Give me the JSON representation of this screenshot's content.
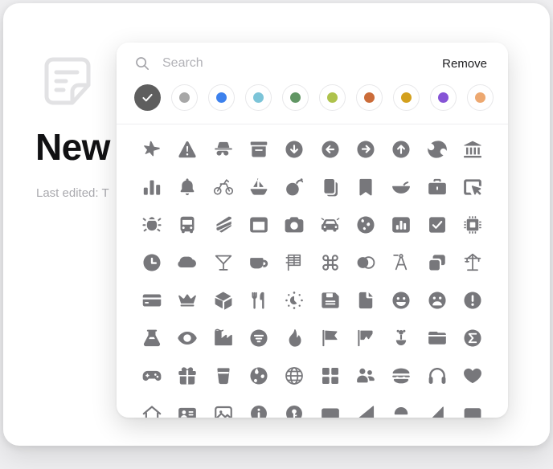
{
  "window": {
    "background_color": "#efeff1",
    "surface_color": "#ffffff"
  },
  "note": {
    "icon": "note-document-icon",
    "title": "New",
    "subtitle": "Last edited: T",
    "subtitle_truncated": true,
    "title_color": "#111113",
    "subtitle_color": "#a9a9ae",
    "icon_color": "#e2e2e4"
  },
  "picker": {
    "name": "icon-picker-popover",
    "search": {
      "icon": "search-icon",
      "value": "",
      "placeholder": "Search"
    },
    "remove_label": "Remove",
    "swatches": [
      {
        "name": "swatch-selected-dark",
        "color": "#5e5e5e",
        "selected": true,
        "icon": "check-icon"
      },
      {
        "name": "swatch-gray",
        "color": "#a7a7a7",
        "selected": false
      },
      {
        "name": "swatch-blue",
        "color": "#3d81ed",
        "selected": false
      },
      {
        "name": "swatch-light-blue",
        "color": "#7cc4d8",
        "selected": false
      },
      {
        "name": "swatch-green",
        "color": "#619664",
        "selected": false
      },
      {
        "name": "swatch-lime",
        "color": "#aec24c",
        "selected": false
      },
      {
        "name": "swatch-orange",
        "color": "#cb6c39",
        "selected": false
      },
      {
        "name": "swatch-amber",
        "color": "#d3a01d",
        "selected": false
      },
      {
        "name": "swatch-purple",
        "color": "#8654d6",
        "selected": false
      },
      {
        "name": "swatch-peach",
        "color": "#eda870",
        "selected": false
      }
    ],
    "icon_color": "#77777b",
    "icons": [
      "airplane-icon",
      "warning-triangle-icon",
      "incognito-icon",
      "archive-box-icon",
      "arrow-down-circle-icon",
      "arrow-left-circle-icon",
      "arrow-right-circle-icon",
      "arrow-up-circle-icon",
      "baseball-icon",
      "bank-icon",
      "bar-chart-icon",
      "bell-icon",
      "bicycle-icon",
      "sailboat-icon",
      "bomb-icon",
      "book-copy-icon",
      "bookmark-icon",
      "bowl-icon",
      "briefcase-icon",
      "button-click-icon",
      "bug-icon",
      "bus-icon",
      "cake-icon",
      "calendar-icon",
      "camera-icon",
      "car-icon",
      "globe-americas-icon",
      "chart-square-icon",
      "checkbox-checked-icon",
      "cpu-chip-icon",
      "clock-icon",
      "cloud-icon",
      "cocktail-icon",
      "coffee-cup-icon",
      "color-grid-icon",
      "command-key-icon",
      "contrast-icon",
      "compass-divider-icon",
      "duplicate-icon",
      "crane-icon",
      "credit-card-icon",
      "crown-icon",
      "cube-icon",
      "cutlery-icon",
      "gauge-icon",
      "floppy-save-icon",
      "document-icon",
      "happy-face-icon",
      "sad-face-icon",
      "exclamation-circle-icon",
      "flask-icon",
      "eye-icon",
      "factory-icon",
      "filter-circle-icon",
      "flame-icon",
      "flag-filled-icon",
      "flag-outline-icon",
      "flower-icon",
      "folder-icon",
      "sigma-circle-icon",
      "gamepad-icon",
      "gift-icon",
      "glass-icon",
      "globe-solid-icon",
      "globe-wire-icon",
      "grid-squares-icon",
      "people-group-icon",
      "hamburger-icon",
      "headphones-icon",
      "heart-icon",
      "home-icon",
      "id-card-icon",
      "image-icon",
      "info-circle-icon",
      "key-circle-icon",
      "keyboard-icon",
      "kite-icon",
      "lamp-icon",
      "leaf-icon",
      "laptop-icon"
    ],
    "visible_rows": 7,
    "partial_row_index": 7
  }
}
